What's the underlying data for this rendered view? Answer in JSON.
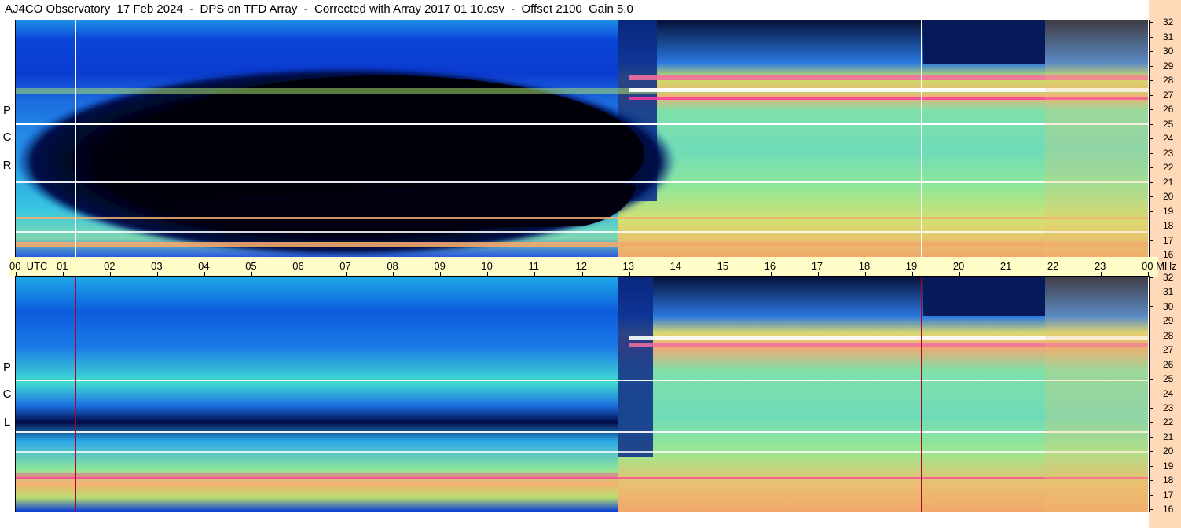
{
  "title": "AJ4CO Observatory  17 Feb 2024  -  DPS on TFD Array  -  Corrected with Array 2017 01 10.csv  -  Offset 2100  Gain 5.0",
  "polarizations": [
    {
      "letters": [
        "R",
        "C",
        "P"
      ]
    },
    {
      "letters": [
        "L",
        "C",
        "P"
      ]
    }
  ],
  "chart_data": {
    "type": "heatmap",
    "title": "AJ4CO Observatory  17 Feb 2024  -  DPS on TFD Array  -  Corrected with Array 2017 01 10.csv  -  Offset 2100  Gain 5.0",
    "xlabel": "UTC",
    "ylabel": "MHz",
    "x_unit_label": "UTC",
    "y_unit_label": "MHz",
    "x_ticks": [
      "00",
      "01",
      "02",
      "03",
      "04",
      "05",
      "06",
      "07",
      "08",
      "09",
      "10",
      "11",
      "12",
      "13",
      "14",
      "15",
      "16",
      "17",
      "18",
      "19",
      "20",
      "21",
      "22",
      "23",
      "00"
    ],
    "x_range_hours": [
      0,
      24
    ],
    "y_range_mhz": [
      16,
      32
    ],
    "y_ticks": [
      "32",
      "31",
      "30",
      "29",
      "28",
      "27",
      "26",
      "25",
      "24",
      "23",
      "22",
      "21",
      "20",
      "19",
      "18",
      "17",
      "16"
    ],
    "panels": [
      {
        "name": "RCP",
        "features": [
          "Low-intensity region 01:30-13:00 UTC",
          "High-intensity bands 13:00-24:00 UTC"
        ]
      },
      {
        "name": "LCP",
        "features": [
          "Intense low band 00:00-13:00 UTC",
          "High-intensity bands 13:00-24:00 UTC"
        ]
      }
    ],
    "colors": {
      "low": "#000010",
      "mid_low": "#0a46d8",
      "mid": "#29c8e8",
      "mid_high": "#9ee87a",
      "high": "#f2b070",
      "peak": "#ff2aa0",
      "saturated": "#ffffff"
    },
    "grid": false
  }
}
